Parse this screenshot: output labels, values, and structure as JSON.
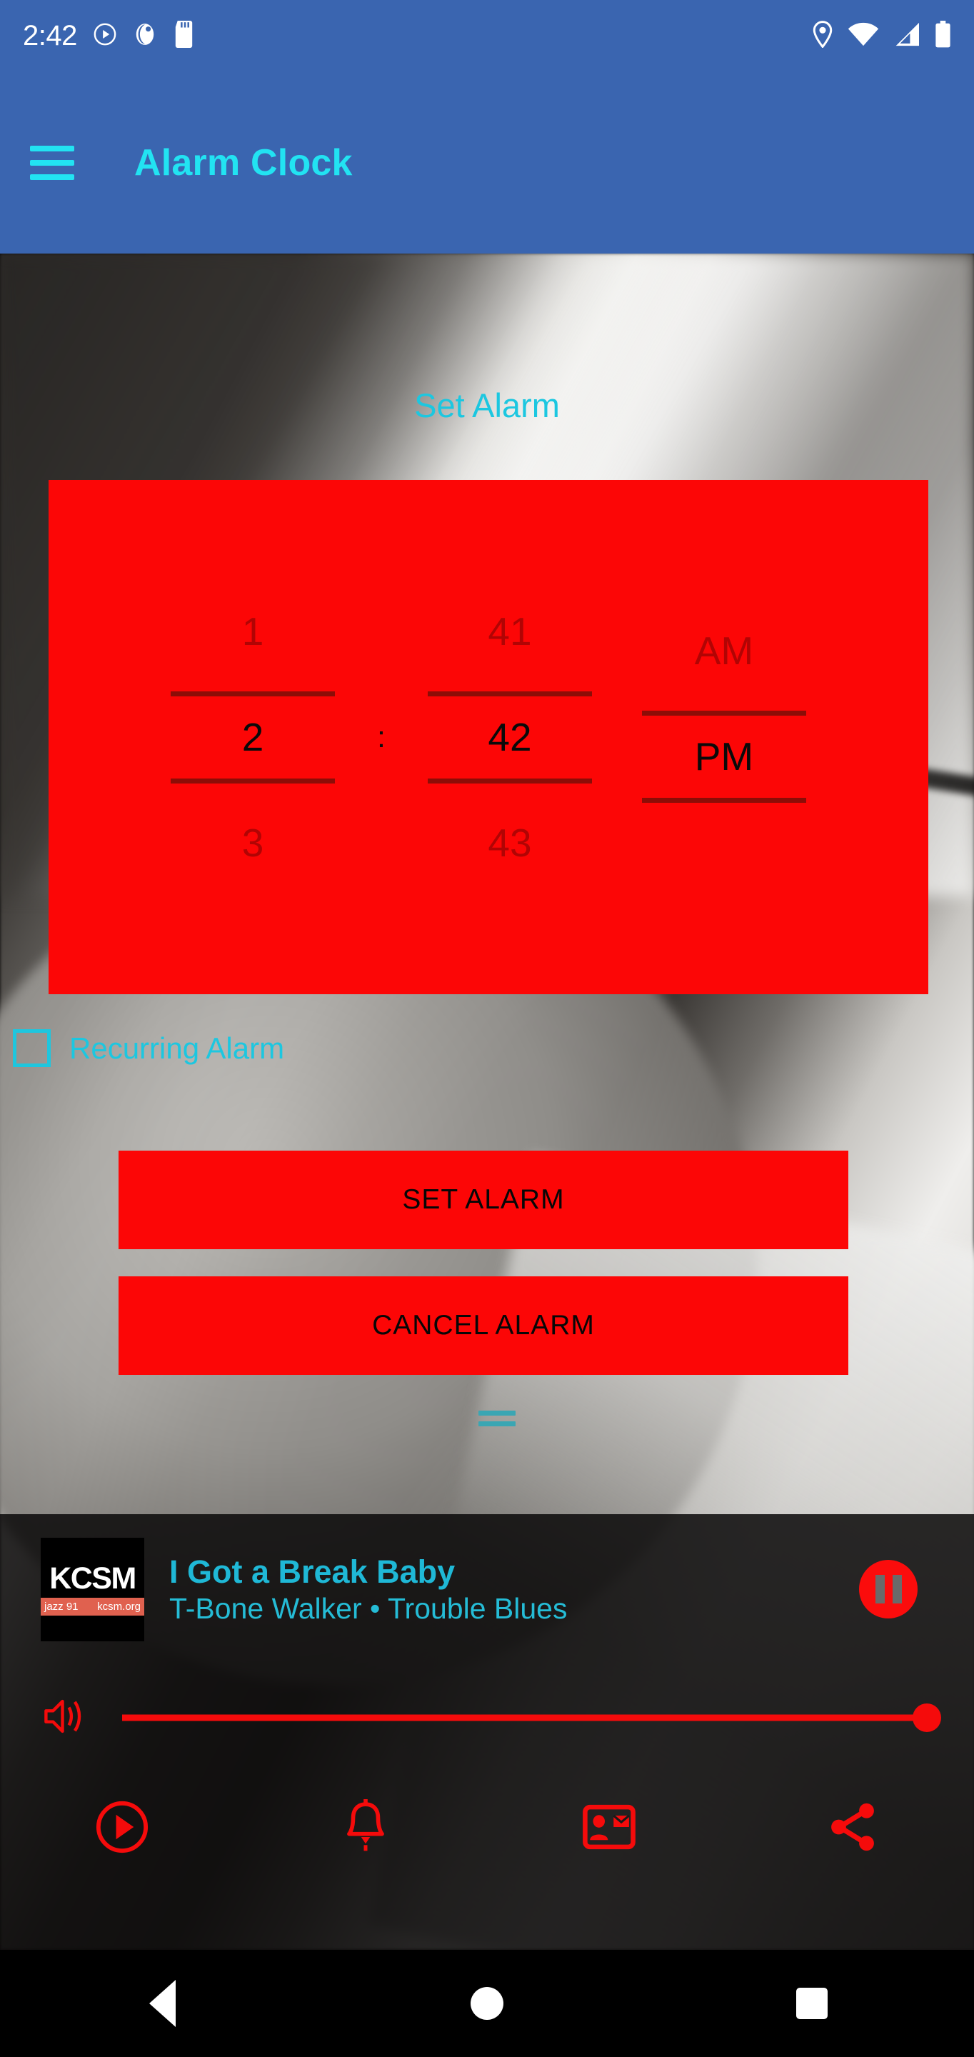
{
  "status_bar": {
    "time": "2:42",
    "left_icons": [
      "play-circle-icon",
      "app-notification-icon",
      "sd-card-icon"
    ],
    "right_icons": [
      "location-pin-icon",
      "wifi-icon",
      "cell-signal-icon",
      "battery-icon"
    ],
    "background_color": "#3a65b0"
  },
  "app_bar": {
    "menu_icon": "hamburger-menu-icon",
    "title": "Alarm Clock",
    "background_color": "#3a65b0",
    "accent_color": "#22e3f2"
  },
  "main": {
    "heading": "Set Alarm",
    "heading_color": "#1cc7e0",
    "time_picker": {
      "background_color": "#fc0606",
      "separator": ":",
      "hour": {
        "previous": "1",
        "current": "2",
        "next": "3"
      },
      "minute": {
        "previous": "41",
        "current": "42",
        "next": "43"
      },
      "meridiem": {
        "previous": "AM",
        "current": "PM",
        "next": ""
      }
    },
    "recurring": {
      "label": "Recurring Alarm",
      "checked": false,
      "color": "#1cc7e0"
    },
    "buttons": {
      "set_alarm": "SET ALARM",
      "cancel_alarm": "CANCEL ALARM",
      "background_color": "#fc0606",
      "text_color": "#070707"
    },
    "drag_handle": "drag-handle-icon"
  },
  "player": {
    "album_art": {
      "station": "KCSM",
      "tagline": "jazz 91",
      "website": "kcsm.org",
      "bar_color": "#e0614f"
    },
    "track_title": "I Got a Break Baby",
    "track_subtitle": "T-Bone Walker • Trouble Blues",
    "title_color": "#1fb8d6",
    "transport_button": "pause-icon",
    "volume": {
      "icon": "volume-up-icon",
      "level": 100,
      "color": "#f50b0b"
    },
    "nav_items": [
      {
        "icon": "play-circle-icon"
      },
      {
        "icon": "alarm-bell-icon"
      },
      {
        "icon": "contact-card-icon"
      },
      {
        "icon": "share-icon"
      }
    ],
    "accent_color": "#f50b0b"
  },
  "android_nav": {
    "back": "back-triangle-icon",
    "home": "home-circle-icon",
    "recents": "recents-square-icon"
  }
}
